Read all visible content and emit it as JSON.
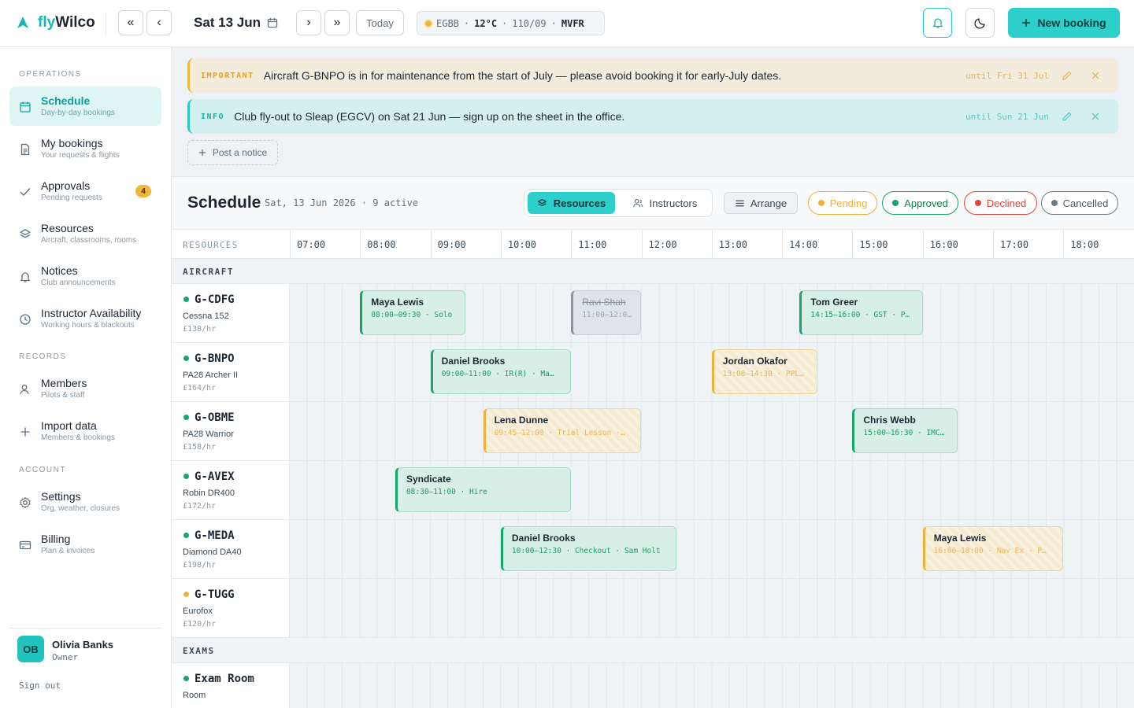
{
  "app": {
    "logo_fly": "fly",
    "logo_wilco": "Wilco",
    "brand_color": "#2ccfca"
  },
  "topbar": {
    "prev_week": "«",
    "prev_day": "‹",
    "next_day": "›",
    "next_week": "»",
    "date": "Sat 13 Jun",
    "today": "Today",
    "weather": {
      "station": "EGBB",
      "temp": "12°C",
      "wind": "110/09",
      "category": "MVFR",
      "sep": "·"
    },
    "new_booking": "New booking"
  },
  "sidebar": {
    "sections": {
      "operations": "OPERATIONS",
      "records": "RECORDS",
      "account": "ACCOUNT"
    },
    "items": [
      {
        "label": "Schedule",
        "sub": "Day-by-day bookings",
        "icon": "calendar-icon"
      },
      {
        "label": "My bookings",
        "sub": "Your requests & flights",
        "icon": "document-icon"
      },
      {
        "label": "Approvals",
        "sub": "Pending requests",
        "icon": "check-icon",
        "badge": "4"
      },
      {
        "label": "Resources",
        "sub": "Aircraft, classrooms, rooms",
        "icon": "layers-icon"
      },
      {
        "label": "Notices",
        "sub": "Club announcements",
        "icon": "bell-icon"
      },
      {
        "label": "Instructor Availability",
        "sub": "Working hours & blackouts",
        "icon": "clock-icon"
      },
      {
        "label": "Members",
        "sub": "Pilots & staff",
        "icon": "user-icon"
      },
      {
        "label": "Import data",
        "sub": "Members & bookings",
        "icon": "plus-icon"
      },
      {
        "label": "Settings",
        "sub": "Org, weather, closures",
        "icon": "gear-icon"
      },
      {
        "label": "Billing",
        "sub": "Plan & invoices",
        "icon": "card-icon"
      }
    ],
    "user": {
      "initials": "OB",
      "name": "Olivia Banks",
      "role": "Owner"
    },
    "sign_out": "Sign out"
  },
  "notices": [
    {
      "tag": "IMPORTANT",
      "text": "Aircraft G-BNPO is in for maintenance from the start of July — please avoid booking it for early-July dates.",
      "until": "until Fri 31 Jul"
    },
    {
      "tag": "INFO",
      "text": "Club fly-out to Sleap (EGCV) on Sat 21 Jun — sign up on the sheet in the office.",
      "until": "until Sun 21 Jun"
    }
  ],
  "post_notice": "Post a notice",
  "schedule": {
    "title": "Schedule",
    "subtitle": "Sat, 13 Jun 2026 · 9 active",
    "view_resources": "Resources",
    "view_instructors": "Instructors",
    "arrange": "Arrange",
    "filters": [
      {
        "label": "Pending",
        "color": "#efb13a"
      },
      {
        "label": "Approved",
        "color": "#16a56a"
      },
      {
        "label": "Declined",
        "color": "#e0463a"
      },
      {
        "label": "Cancelled",
        "color": "#6d7a86"
      }
    ],
    "resources_header": "RESOURCES",
    "hours": [
      "07:00",
      "08:00",
      "09:00",
      "10:00",
      "11:00",
      "12:00",
      "13:00",
      "14:00",
      "15:00",
      "16:00",
      "17:00",
      "18:00"
    ],
    "groups": [
      {
        "name": "AIRCRAFT",
        "resources": [
          {
            "reg": "G-CDFG",
            "type": "Cessna 152",
            "rate": "£138/hr",
            "status": "#16a56a",
            "bookings": [
              {
                "who": "Maya Lewis",
                "meta": "08:00–09:30 · Solo",
                "start": 8,
                "end": 9.5,
                "status": "approved"
              },
              {
                "who": "Ravi Shah",
                "meta": "11:00–12:0…",
                "start": 11,
                "end": 12,
                "status": "cancelled"
              },
              {
                "who": "Tom Greer",
                "meta": "14:15–16:00 · GST · P…",
                "start": 14.25,
                "end": 16,
                "status": "approved"
              }
            ]
          },
          {
            "reg": "G-BNPO",
            "type": "PA28 Archer II",
            "rate": "£164/hr",
            "status": "#16a56a",
            "bookings": [
              {
                "who": "Daniel Brooks",
                "meta": "09:00–11:00 · IR(R) · Ma…",
                "start": 9,
                "end": 11,
                "status": "approved"
              },
              {
                "who": "Jordan Okafor",
                "meta": "13:00–14:30 · PPL…",
                "start": 13,
                "end": 14.5,
                "status": "pending"
              }
            ]
          },
          {
            "reg": "G-OBME",
            "type": "PA28 Warrior",
            "rate": "£158/hr",
            "status": "#16a56a",
            "bookings": [
              {
                "who": "Lena Dunne",
                "meta": "09:45–12:00 · Trial Lesson ·…",
                "start": 9.75,
                "end": 12,
                "status": "pending"
              },
              {
                "who": "Chris Webb",
                "meta": "15:00–16:30 · IMC…",
                "start": 15,
                "end": 16.5,
                "status": "approved"
              }
            ]
          },
          {
            "reg": "G-AVEX",
            "type": "Robin DR400",
            "rate": "£172/hr",
            "status": "#16a56a",
            "bookings": [
              {
                "who": "Syndicate",
                "meta": "08:30–11:00 · Hire",
                "start": 8.5,
                "end": 11,
                "status": "approved"
              }
            ]
          },
          {
            "reg": "G-MEDA",
            "type": "Diamond DA40",
            "rate": "£198/hr",
            "status": "#16a56a",
            "bookings": [
              {
                "who": "Daniel Brooks",
                "meta": "10:00–12:30 · Checkout · Sam Holt",
                "start": 10,
                "end": 12.5,
                "status": "approved"
              },
              {
                "who": "Maya Lewis",
                "meta": "16:00–18:00 · Nav Ex · P…",
                "start": 16,
                "end": 18,
                "status": "pending"
              }
            ]
          },
          {
            "reg": "G-TUGG",
            "type": "Eurofox",
            "rate": "£120/hr",
            "status": "#efb13a",
            "bookings": []
          }
        ]
      },
      {
        "name": "EXAMS",
        "resources": [
          {
            "reg": "Exam Room",
            "type": "Room",
            "rate": "",
            "status": "#16a56a",
            "bookings": []
          }
        ]
      }
    ]
  }
}
